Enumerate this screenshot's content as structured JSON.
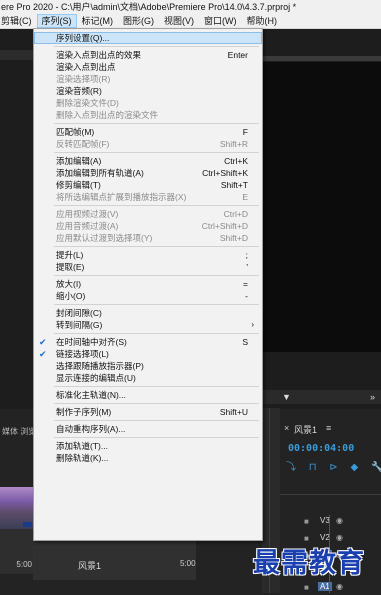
{
  "window": {
    "title": "ere Pro 2020 - C:\\用户\\admin\\文档\\Adobe\\Premiere Pro\\14.0\\4.3.7.prproj *"
  },
  "menubar": {
    "items": [
      {
        "label": "剪辑(C)",
        "active": false
      },
      {
        "label": "序列(S)",
        "active": true
      },
      {
        "label": "标记(M)",
        "active": false
      },
      {
        "label": "图形(G)",
        "active": false
      },
      {
        "label": "视图(V)",
        "active": false
      },
      {
        "label": "窗口(W)",
        "active": false
      },
      {
        "label": "帮助(H)",
        "active": false
      }
    ]
  },
  "menu": {
    "items": [
      {
        "label": "序列设置(Q)...",
        "shortcut": "",
        "disabled": false,
        "checked": false,
        "highlighted": true
      },
      {
        "separator": true
      },
      {
        "label": "渲染入点到出点的效果",
        "shortcut": "Enter",
        "disabled": false,
        "checked": false
      },
      {
        "label": "渲染入点到出点",
        "shortcut": "",
        "disabled": false,
        "checked": false
      },
      {
        "label": "渲染选择项(R)",
        "shortcut": "",
        "disabled": true,
        "checked": false
      },
      {
        "label": "渲染音频(R)",
        "shortcut": "",
        "disabled": false,
        "checked": false
      },
      {
        "label": "删除渲染文件(D)",
        "shortcut": "",
        "disabled": true,
        "checked": false
      },
      {
        "label": "删除入点到出点的渲染文件",
        "shortcut": "",
        "disabled": true,
        "checked": false
      },
      {
        "separator": true
      },
      {
        "label": "匹配帧(M)",
        "shortcut": "F",
        "disabled": false,
        "checked": false
      },
      {
        "label": "反转匹配帧(F)",
        "shortcut": "Shift+R",
        "disabled": true,
        "checked": false
      },
      {
        "separator": true
      },
      {
        "label": "添加编辑(A)",
        "shortcut": "Ctrl+K",
        "disabled": false,
        "checked": false
      },
      {
        "label": "添加编辑到所有轨道(A)",
        "shortcut": "Ctrl+Shift+K",
        "disabled": false,
        "checked": false
      },
      {
        "label": "修剪编辑(T)",
        "shortcut": "Shift+T",
        "disabled": false,
        "checked": false
      },
      {
        "label": "将所选编辑点扩展到播放指示器(X)",
        "shortcut": "E",
        "disabled": true,
        "checked": false
      },
      {
        "separator": true
      },
      {
        "label": "应用视频过渡(V)",
        "shortcut": "Ctrl+D",
        "disabled": true,
        "checked": false
      },
      {
        "label": "应用音频过渡(A)",
        "shortcut": "Ctrl+Shift+D",
        "disabled": true,
        "checked": false
      },
      {
        "label": "应用默认过渡到选择项(Y)",
        "shortcut": "Shift+D",
        "disabled": true,
        "checked": false
      },
      {
        "separator": true
      },
      {
        "label": "提升(L)",
        "shortcut": ";",
        "disabled": false,
        "checked": false
      },
      {
        "label": "提取(E)",
        "shortcut": "'",
        "disabled": false,
        "checked": false
      },
      {
        "separator": true
      },
      {
        "label": "放大(I)",
        "shortcut": "=",
        "disabled": false,
        "checked": false
      },
      {
        "label": "缩小(O)",
        "shortcut": "-",
        "disabled": false,
        "checked": false
      },
      {
        "separator": true
      },
      {
        "label": "封闭间隙(C)",
        "shortcut": "",
        "disabled": false,
        "checked": false
      },
      {
        "label": "转到间隔(G)",
        "shortcut": "",
        "disabled": false,
        "checked": false,
        "submenu": true
      },
      {
        "separator": true
      },
      {
        "label": "在时间轴中对齐(S)",
        "shortcut": "S",
        "disabled": false,
        "checked": true
      },
      {
        "label": "链接选择项(L)",
        "shortcut": "",
        "disabled": false,
        "checked": true
      },
      {
        "label": "选择跟随播放指示器(P)",
        "shortcut": "",
        "disabled": false,
        "checked": false
      },
      {
        "label": "显示连接的编辑点(U)",
        "shortcut": "",
        "disabled": false,
        "checked": false
      },
      {
        "separator": true
      },
      {
        "label": "标准化主轨道(N)...",
        "shortcut": "",
        "disabled": false,
        "checked": false
      },
      {
        "separator": true
      },
      {
        "label": "制作子序列(M)",
        "shortcut": "Shift+U",
        "disabled": false,
        "checked": false
      },
      {
        "separator": true
      },
      {
        "label": "自动重构序列(A)...",
        "shortcut": "",
        "disabled": false,
        "checked": false
      },
      {
        "separator": true
      },
      {
        "label": "添加轨道(T)...",
        "shortcut": "",
        "disabled": false,
        "checked": false
      },
      {
        "label": "删除轨道(K)...",
        "shortcut": "",
        "disabled": false,
        "checked": false
      }
    ]
  },
  "project_panel": {
    "tab_label": "媒体 浏览",
    "clip_name": "风景1",
    "clip_duration": "5:00",
    "left_clip_duration": "5:00"
  },
  "timeline": {
    "close_glyph": "×",
    "title": "风景1",
    "menu_glyph": "≡",
    "timecode": "00:00:04:00",
    "tool_icons": "⤵ ⊓ ⊳ ◆ 🔧",
    "tracks": [
      {
        "name": "V3",
        "selected": false
      },
      {
        "name": "V2",
        "selected": false
      },
      {
        "name": "V1",
        "selected": true
      },
      {
        "name": "A1",
        "selected": true
      }
    ]
  },
  "program_monitor": {
    "marker_glyph": "▼",
    "menu_glyph": "»"
  },
  "watermark": {
    "text": "最需教育"
  }
}
